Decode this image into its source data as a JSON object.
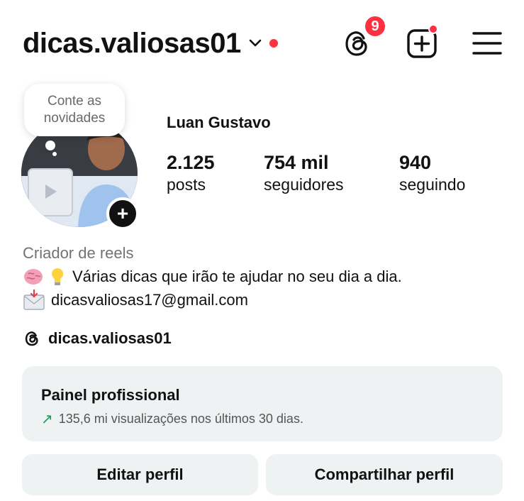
{
  "header": {
    "username": "dicas.valiosas01",
    "threads_badge": "9",
    "icons": [
      "chevron-down-icon",
      "threads-icon",
      "add-post-icon",
      "hamburger-menu-icon"
    ],
    "accent_color": "#ff3040"
  },
  "note": {
    "text": "Conte as novidades"
  },
  "profile": {
    "full_name": "Luan Gustavo",
    "stats": [
      {
        "value": "2.125",
        "label": "posts"
      },
      {
        "value": "754 mil",
        "label": "seguidores"
      },
      {
        "value": "940",
        "label": "seguindo"
      }
    ]
  },
  "bio": {
    "category": "Criador de reels",
    "line1": "Várias dicas que irão te ajudar no seu dia a dia.",
    "line1_emojis": [
      "brain-icon",
      "lightbulb-icon"
    ],
    "line2": "dicasvaliosas17@gmail.com",
    "line2_emoji": "envelope-icon",
    "threads_handle": "dicas.valiosas01"
  },
  "professional_panel": {
    "title": "Painel profissional",
    "subtitle": "135,6 mi visualizações nos últimos 30 dias.",
    "trend_color": "#1e9b5a"
  },
  "actions": {
    "edit": "Editar perfil",
    "share": "Compartilhar perfil"
  }
}
